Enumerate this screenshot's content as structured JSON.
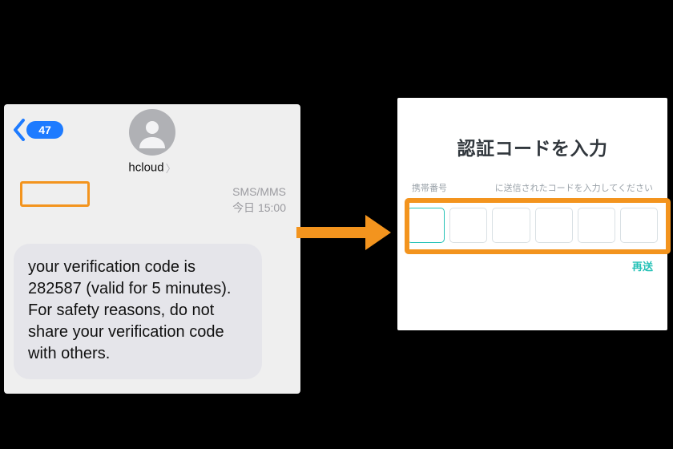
{
  "sms": {
    "back_badge": "47",
    "sender": "hcloud",
    "channel": "SMS/MMS",
    "timestamp": "今日 15:00",
    "message": "your verification code is 282587 (valid for 5 minutes). For safety reasons, do not share your verification code with others.",
    "highlighted_code": "282587"
  },
  "verify": {
    "title": "認証コードを入力",
    "phone_label": "携帯番号",
    "instruction": "に送信されたコードを入力してください",
    "resend": "再送",
    "digit_count": 6
  },
  "colors": {
    "highlight": "#f3941e",
    "ios_blue": "#1e7bff",
    "accent": "#24c1b6"
  }
}
